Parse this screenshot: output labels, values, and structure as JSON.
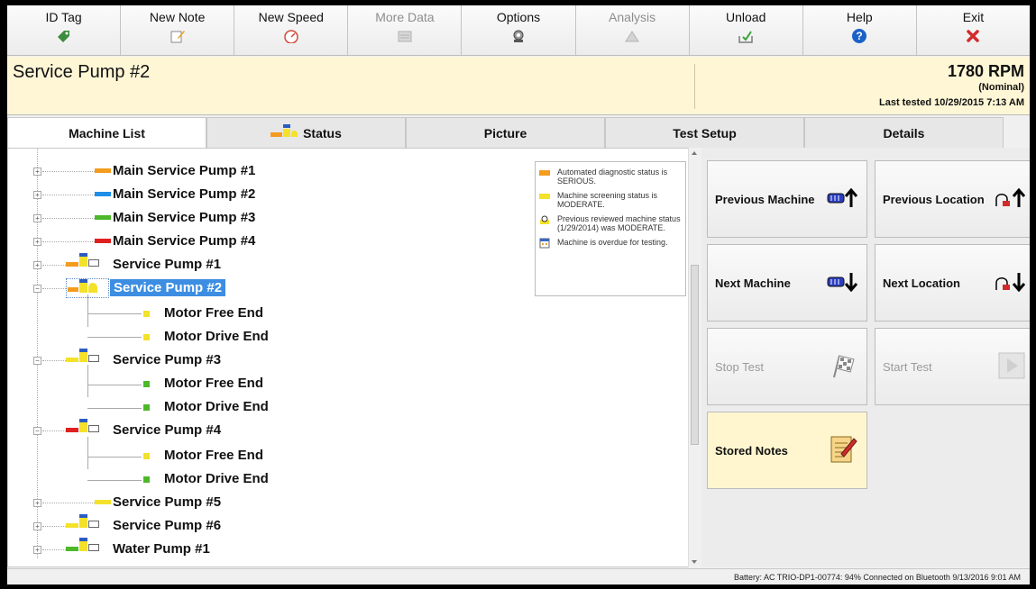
{
  "toolbar": {
    "items": [
      {
        "label": "ID Tag",
        "icon": "tag-icon",
        "enabled": true
      },
      {
        "label": "New Note",
        "icon": "note-icon",
        "enabled": true
      },
      {
        "label": "New Speed",
        "icon": "gauge-icon",
        "enabled": true
      },
      {
        "label": "More Data",
        "icon": "data-icon",
        "enabled": false
      },
      {
        "label": "Options",
        "icon": "options-icon",
        "enabled": true
      },
      {
        "label": "Analysis",
        "icon": "analysis-icon",
        "enabled": false
      },
      {
        "label": "Unload",
        "icon": "unload-icon",
        "enabled": true
      },
      {
        "label": "Help",
        "icon": "help-icon",
        "enabled": true
      },
      {
        "label": "Exit",
        "icon": "exit-icon",
        "enabled": true
      }
    ]
  },
  "header": {
    "title": "Service Pump #2",
    "rpm": "1780 RPM",
    "rpm_note": "(Nominal)",
    "last_tested": "Last tested 10/29/2015 7:13 AM"
  },
  "tabs": [
    {
      "label": "Machine List",
      "active": true
    },
    {
      "label": "Status",
      "active": false
    },
    {
      "label": "Picture",
      "active": false
    },
    {
      "label": "Test Setup",
      "active": false
    },
    {
      "label": "Details",
      "active": false
    }
  ],
  "tree": [
    {
      "label": "Main Service Pump #1",
      "level": 0,
      "bar": "#f39c1e"
    },
    {
      "label": "Main Service Pump #2",
      "level": 0,
      "bar": "#1e8fe8"
    },
    {
      "label": "Main Service Pump #3",
      "level": 0,
      "bar": "#4db82a"
    },
    {
      "label": "Main Service Pump #4",
      "level": 0,
      "bar": "#e02020"
    },
    {
      "label": "Service Pump #1",
      "level": 0,
      "bar": "#f39c1e"
    },
    {
      "label": "Service Pump #2",
      "level": 0,
      "bar": "#f39c1e",
      "selected": true
    },
    {
      "label": "Motor Free End",
      "level": 1,
      "bar": "#f4e12a"
    },
    {
      "label": "Motor Drive End",
      "level": 1,
      "bar": "#f4e12a"
    },
    {
      "label": "Service Pump #3",
      "level": 0,
      "bar": "#f4e12a"
    },
    {
      "label": "Motor Free End",
      "level": 1,
      "bar": "#4db82a"
    },
    {
      "label": "Motor Drive End",
      "level": 1,
      "bar": "#4db82a"
    },
    {
      "label": "Service Pump #4",
      "level": 0,
      "bar": "#e02020"
    },
    {
      "label": "Motor Free End",
      "level": 1,
      "bar": "#f4e12a"
    },
    {
      "label": "Motor Drive End",
      "level": 1,
      "bar": "#4db82a"
    },
    {
      "label": "Service Pump #5",
      "level": 0,
      "bar": "#f4e12a"
    },
    {
      "label": "Service Pump #6",
      "level": 0,
      "bar": "#f4e12a"
    },
    {
      "label": "Water Pump #1",
      "level": 0,
      "bar": "#4db82a"
    }
  ],
  "legend": [
    {
      "text": "Automated diagnostic status is SERIOUS.",
      "swatch": "#f39c1e"
    },
    {
      "text": "Machine screening status is MODERATE.",
      "swatch": "#f4e12a"
    },
    {
      "text": "Previous reviewed machine status (1/29/2014) was MODERATE.",
      "swatch": "clock"
    },
    {
      "text": "Machine is overdue for testing.",
      "swatch": "calendar"
    }
  ],
  "buttons": {
    "previous_machine": "Previous Machine",
    "previous_location": "Previous Location",
    "next_machine": "Next Machine",
    "next_location": "Next Location",
    "stop_test": "Stop Test",
    "start_test": "Start Test",
    "stored_notes": "Stored Notes"
  },
  "status_bar": "Battery: AC  TRIO-DP1-00774: 94%  Connected on Bluetooth   9/13/2016  9:01 AM"
}
